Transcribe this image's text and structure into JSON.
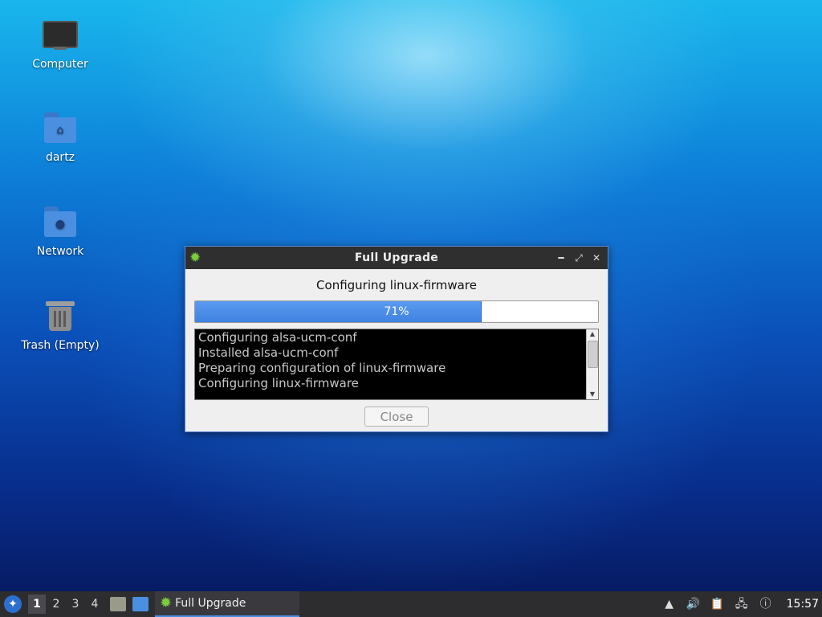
{
  "desktop": {
    "icons": [
      {
        "label": "Computer",
        "icon": "computer-icon"
      },
      {
        "label": "dartz",
        "icon": "home-folder-icon"
      },
      {
        "label": "Network",
        "icon": "network-folder-icon"
      },
      {
        "label": "Trash (Empty)",
        "icon": "trash-icon"
      }
    ]
  },
  "dialog": {
    "title": "Full Upgrade",
    "status": "Configuring linux-firmware",
    "progress": {
      "percent": 71,
      "label": "71%"
    },
    "log_lines": [
      "Configuring alsa-ucm-conf",
      "Installed alsa-ucm-conf",
      "Preparing configuration of linux-firmware",
      "Configuring linux-firmware"
    ],
    "close_label": "Close"
  },
  "taskbar": {
    "workspaces": [
      "1",
      "2",
      "3",
      "4"
    ],
    "active_workspace": 0,
    "task_label": "Full Upgrade",
    "clock": "15:57"
  },
  "colors": {
    "accent": "#4a8fe0",
    "gear": "#7ccd3c",
    "taskbar": "#2d2d30"
  }
}
